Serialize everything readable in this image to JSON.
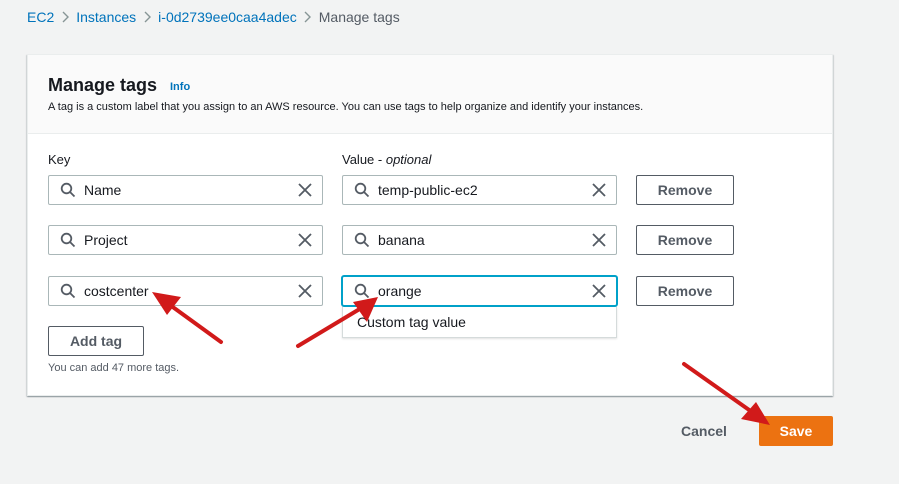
{
  "breadcrumb": {
    "items": [
      "EC2",
      "Instances",
      "i-0d2739ee0caa4adec"
    ],
    "current": "Manage tags"
  },
  "panel": {
    "title": "Manage tags",
    "info": "Info",
    "description": "A tag is a custom label that you assign to an AWS resource. You can use tags to help organize and identify your instances."
  },
  "columns": {
    "key": "Key",
    "value": "Value - ",
    "value_optional": "optional"
  },
  "tags": [
    {
      "key": "Name",
      "value": "temp-public-ec2",
      "remove": "Remove"
    },
    {
      "key": "Project",
      "value": "banana",
      "remove": "Remove"
    },
    {
      "key": "costcenter",
      "value": "orange",
      "remove": "Remove"
    }
  ],
  "suggestion": "Custom tag value",
  "add_tag": "Add tag",
  "hint": "You can add 47 more tags.",
  "footer": {
    "cancel": "Cancel",
    "save": "Save"
  },
  "colors": {
    "link": "#0073bb",
    "primary": "#ec7211",
    "focus": "#00a1c9",
    "annotation_arrow": "#d11a1a"
  }
}
